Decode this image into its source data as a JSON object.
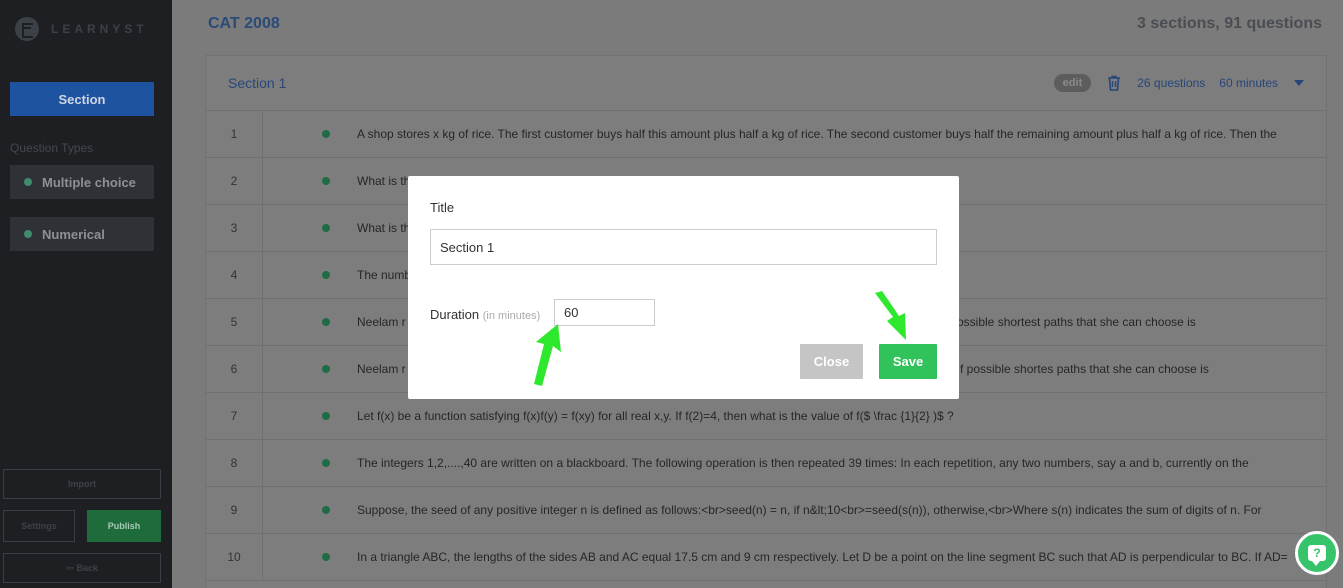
{
  "brand": {
    "name": "LEARNYST"
  },
  "sidebar": {
    "section_button": "Section",
    "question_types_label": "Question Types",
    "question_types": [
      "Multiple choice",
      "Numerical"
    ],
    "import_label": "Import",
    "settings_label": "Settings",
    "publish_label": "Publish",
    "back_label": "Back"
  },
  "header": {
    "title": "CAT 2008",
    "summary": "3 sections, 91 questions"
  },
  "section": {
    "title": "Section 1",
    "edit_label": "edit",
    "questions_count": "26 questions",
    "duration": "60 minutes"
  },
  "questions": [
    {
      "num": "1",
      "text": "A shop stores x kg of rice. The first customer buys half this amount plus half a kg of rice. The second customer buys half the remaining amount plus half a kg of rice. Then the"
    },
    {
      "num": "2",
      "text": "What is th"
    },
    {
      "num": "3",
      "text": "What is th"
    },
    {
      "num": "4",
      "text": "The numb"
    },
    {
      "num": "5",
      "text": "Neelam r",
      "tail": "ossible shortest paths that she can choose is"
    },
    {
      "num": "6",
      "text": "Neelam r",
      "tail": "f possible shortes paths that she can choose is"
    },
    {
      "num": "7",
      "text": "Let f(x) be a function satisfying f(x)f(y) = f(xy) for all real x,y. If f(2)=4, then what is the value of f($ \\frac {1}{2} )$ ?"
    },
    {
      "num": "8",
      "text": "The integers 1,2,....,40 are written on a blackboard. The following operation is then repeated 39 times: In each repetition, any two numbers, say a and b, currently on the"
    },
    {
      "num": "9",
      "text": "Suppose, the seed of any positive integer n is defined as follows:<br>seed(n) = n, if n&lt;10<br>=seed(s(n)), otherwise,<br>Where s(n) indicates the sum of digits of n. For"
    },
    {
      "num": "10",
      "text": "In a triangle ABC, the lengths of the sides AB and AC equal 17.5 cm and 9 cm respectively. Let D be a point on the line segment BC such that AD is perpendicular to BC. If AD="
    }
  ],
  "modal": {
    "title_label": "Title",
    "title_value": "Section 1",
    "duration_label": "Duration",
    "duration_hint": "(in minutes)",
    "duration_value": "60",
    "close_label": "Close",
    "save_label": "Save"
  },
  "help": {
    "icon": "?"
  },
  "colors": {
    "accent_blue": "#1e53a0",
    "save_green": "#31c25c",
    "arrow_green": "#2ee82e"
  }
}
